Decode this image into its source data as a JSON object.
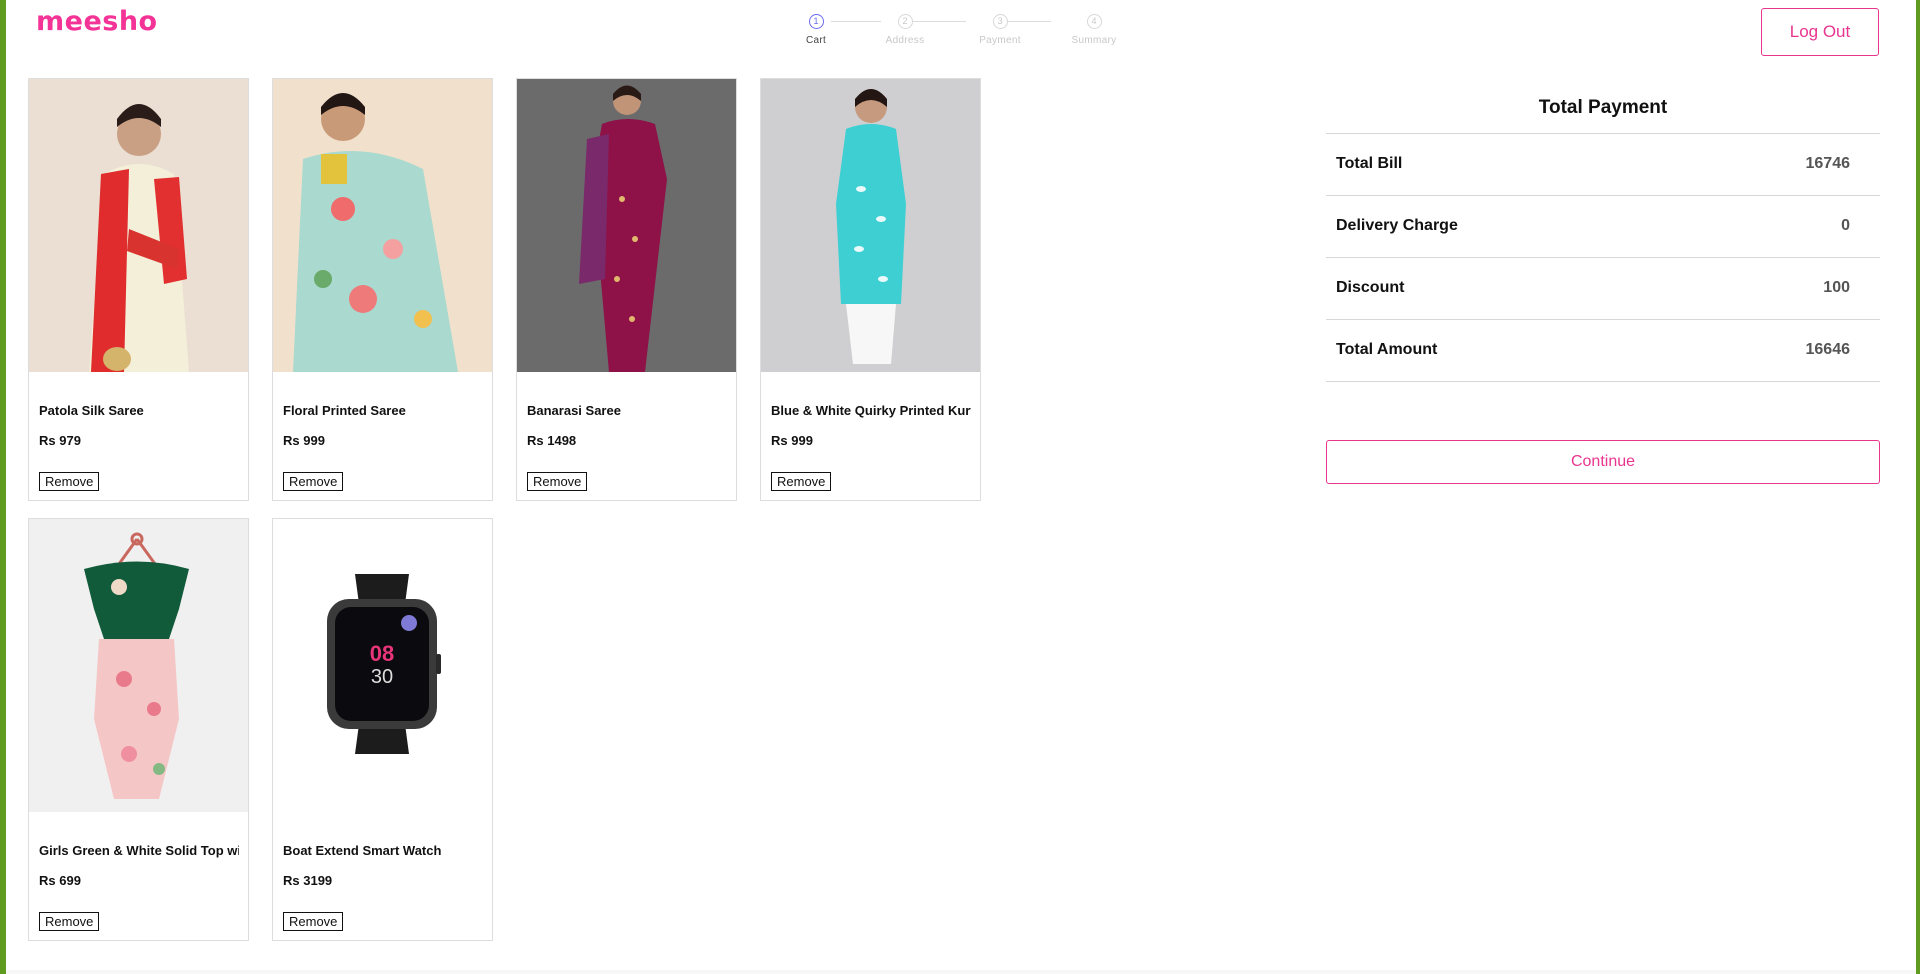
{
  "header": {
    "logo": "meesho",
    "logout_label": "Log Out",
    "steps": [
      {
        "num": "1",
        "label": "Cart",
        "active": true
      },
      {
        "num": "2",
        "label": "Address",
        "active": false
      },
      {
        "num": "3",
        "label": "Payment",
        "active": false
      },
      {
        "num": "4",
        "label": "Summary",
        "active": false
      }
    ]
  },
  "cart": {
    "remove_label": "Remove",
    "items": [
      {
        "name": "Patola Silk Saree",
        "price": "Rs 979"
      },
      {
        "name": "Floral Printed Saree",
        "price": "Rs 999"
      },
      {
        "name": "Banarasi Saree",
        "price": "Rs 1498"
      },
      {
        "name": "Blue & White Quirky Printed Kurta",
        "price": "Rs 999"
      },
      {
        "name": "Girls Green & White Solid Top with Dhoti Pants",
        "price": "Rs 699"
      },
      {
        "name": "Boat Extend Smart Watch",
        "price": "Rs 3199"
      }
    ]
  },
  "summary": {
    "title": "Total Payment",
    "rows": [
      {
        "label": "Total Bill",
        "value": "16746"
      },
      {
        "label": "Delivery Charge",
        "value": "0"
      },
      {
        "label": "Discount",
        "value": "100"
      },
      {
        "label": "Total Amount",
        "value": "16646"
      }
    ],
    "continue_label": "Continue"
  },
  "colors": {
    "brand": "#f43397",
    "accent_button": "#e8358f",
    "frame": "#5f9b1e"
  }
}
